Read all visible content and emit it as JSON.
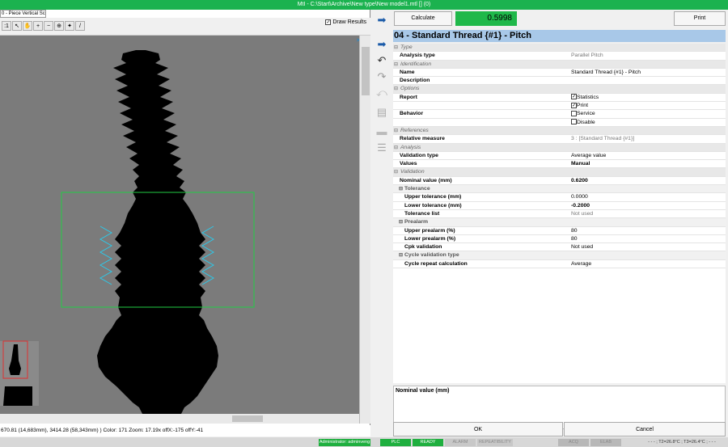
{
  "window": {
    "title": "MtI - C:\\Start\\Archive\\New type\\New model1.mtl [] (0)"
  },
  "left_panel": {
    "tab_label": "0 - Piece Vertical Scan",
    "draw_results_label": "Draw Results",
    "draw_results_checked": true,
    "status_text": "670.81 (14,683mm), 3414.28 (58,343mm) ) Color: 171   Zoom: 17.19x   offX:-175  offY:-41"
  },
  "toolbar": {
    "buttons": [
      {
        "name": "zoom-1to1-button",
        "glyph": ":1"
      },
      {
        "name": "pointer-button",
        "glyph": "↖"
      },
      {
        "name": "pan-button",
        "glyph": "✋"
      },
      {
        "name": "zoom-in-button",
        "glyph": "+"
      },
      {
        "name": "zoom-out-button",
        "glyph": "−"
      },
      {
        "name": "zoom-fit-button",
        "glyph": "⊕"
      },
      {
        "name": "magic-wand-button",
        "glyph": "✦"
      },
      {
        "name": "measure-line-button",
        "glyph": "/"
      }
    ]
  },
  "right_panel": {
    "calculate_label": "Calculate",
    "result_value": "0.5998",
    "print_label": "Print",
    "header_title": "04 - Standard Thread {#1} - Pitch",
    "properties": [
      {
        "kind": "category",
        "label": "Type"
      },
      {
        "kind": "prop",
        "key": "Analysis type",
        "value": "Parallel Pitch",
        "grey": true
      },
      {
        "kind": "category",
        "label": "Identification"
      },
      {
        "kind": "prop",
        "key": "Name",
        "value": "Standard Thread {#1} - Pitch"
      },
      {
        "kind": "prop",
        "key": "Description",
        "value": ""
      },
      {
        "kind": "category",
        "label": "Options"
      },
      {
        "kind": "check",
        "key": "Report",
        "value": "Statistics",
        "checked": true
      },
      {
        "kind": "check",
        "key": "",
        "value": "Print",
        "checked": true
      },
      {
        "kind": "check",
        "key": "Behavior",
        "value": "Service",
        "checked": false
      },
      {
        "kind": "check",
        "key": "",
        "value": "Disable",
        "checked": false
      },
      {
        "kind": "category",
        "label": "References"
      },
      {
        "kind": "prop",
        "key": "Relative measure",
        "value": "3 : [Standard Thread {#1}]",
        "grey": true
      },
      {
        "kind": "category",
        "label": "Analysis"
      },
      {
        "kind": "prop",
        "key": "Validation type",
        "value": "Average value"
      },
      {
        "kind": "prop",
        "key": "Values",
        "value": "Manual",
        "bold": true
      },
      {
        "kind": "category",
        "label": "Validation"
      },
      {
        "kind": "prop",
        "key": "Nominal value (mm)",
        "value": "0.6200",
        "bold": true
      },
      {
        "kind": "sub",
        "label": "Tolerance"
      },
      {
        "kind": "prop",
        "key": "Upper tolerance (mm)",
        "value": "0.0000",
        "indent": true
      },
      {
        "kind": "prop",
        "key": "Lower tolerance (mm)",
        "value": "-0.2000",
        "bold": true,
        "indent": true
      },
      {
        "kind": "prop",
        "key": "Tolerance list",
        "value": "Not used",
        "grey": true,
        "indent": true
      },
      {
        "kind": "sub",
        "label": "Prealarm"
      },
      {
        "kind": "prop",
        "key": "Upper prealarm (%)",
        "value": "80",
        "indent": true
      },
      {
        "kind": "prop",
        "key": "Lower prealarm (%)",
        "value": "80",
        "indent": true
      },
      {
        "kind": "prop",
        "key": "Cpk validation",
        "value": "Not used",
        "indent": true
      },
      {
        "kind": "sub",
        "label": "Cycle validation type"
      },
      {
        "kind": "prop",
        "key": "Cycle repeat calculation",
        "value": "Average",
        "indent": true
      }
    ],
    "description_title": "Nominal value (mm)",
    "ok_label": "OK",
    "cancel_label": "Cancel"
  },
  "status_bar": {
    "user": "Administrator: adminveng",
    "plc": "PLC",
    "ready": "READY",
    "alarm": "ALARM",
    "repeatability": "REPEATIBILITY",
    "acq": "ACQ",
    "elab": "ELAB",
    "temps": "- - - ; T2=26.8°C ; T3=26.4°C ; - - -"
  },
  "colors": {
    "title_bar": "#1bb24f",
    "result_ok": "#1fb84a",
    "header_bg": "#a8c8e8",
    "status_green": "#1faf3f",
    "roi_green": "#22cc44",
    "thread_markers": "#2ec8e8"
  }
}
